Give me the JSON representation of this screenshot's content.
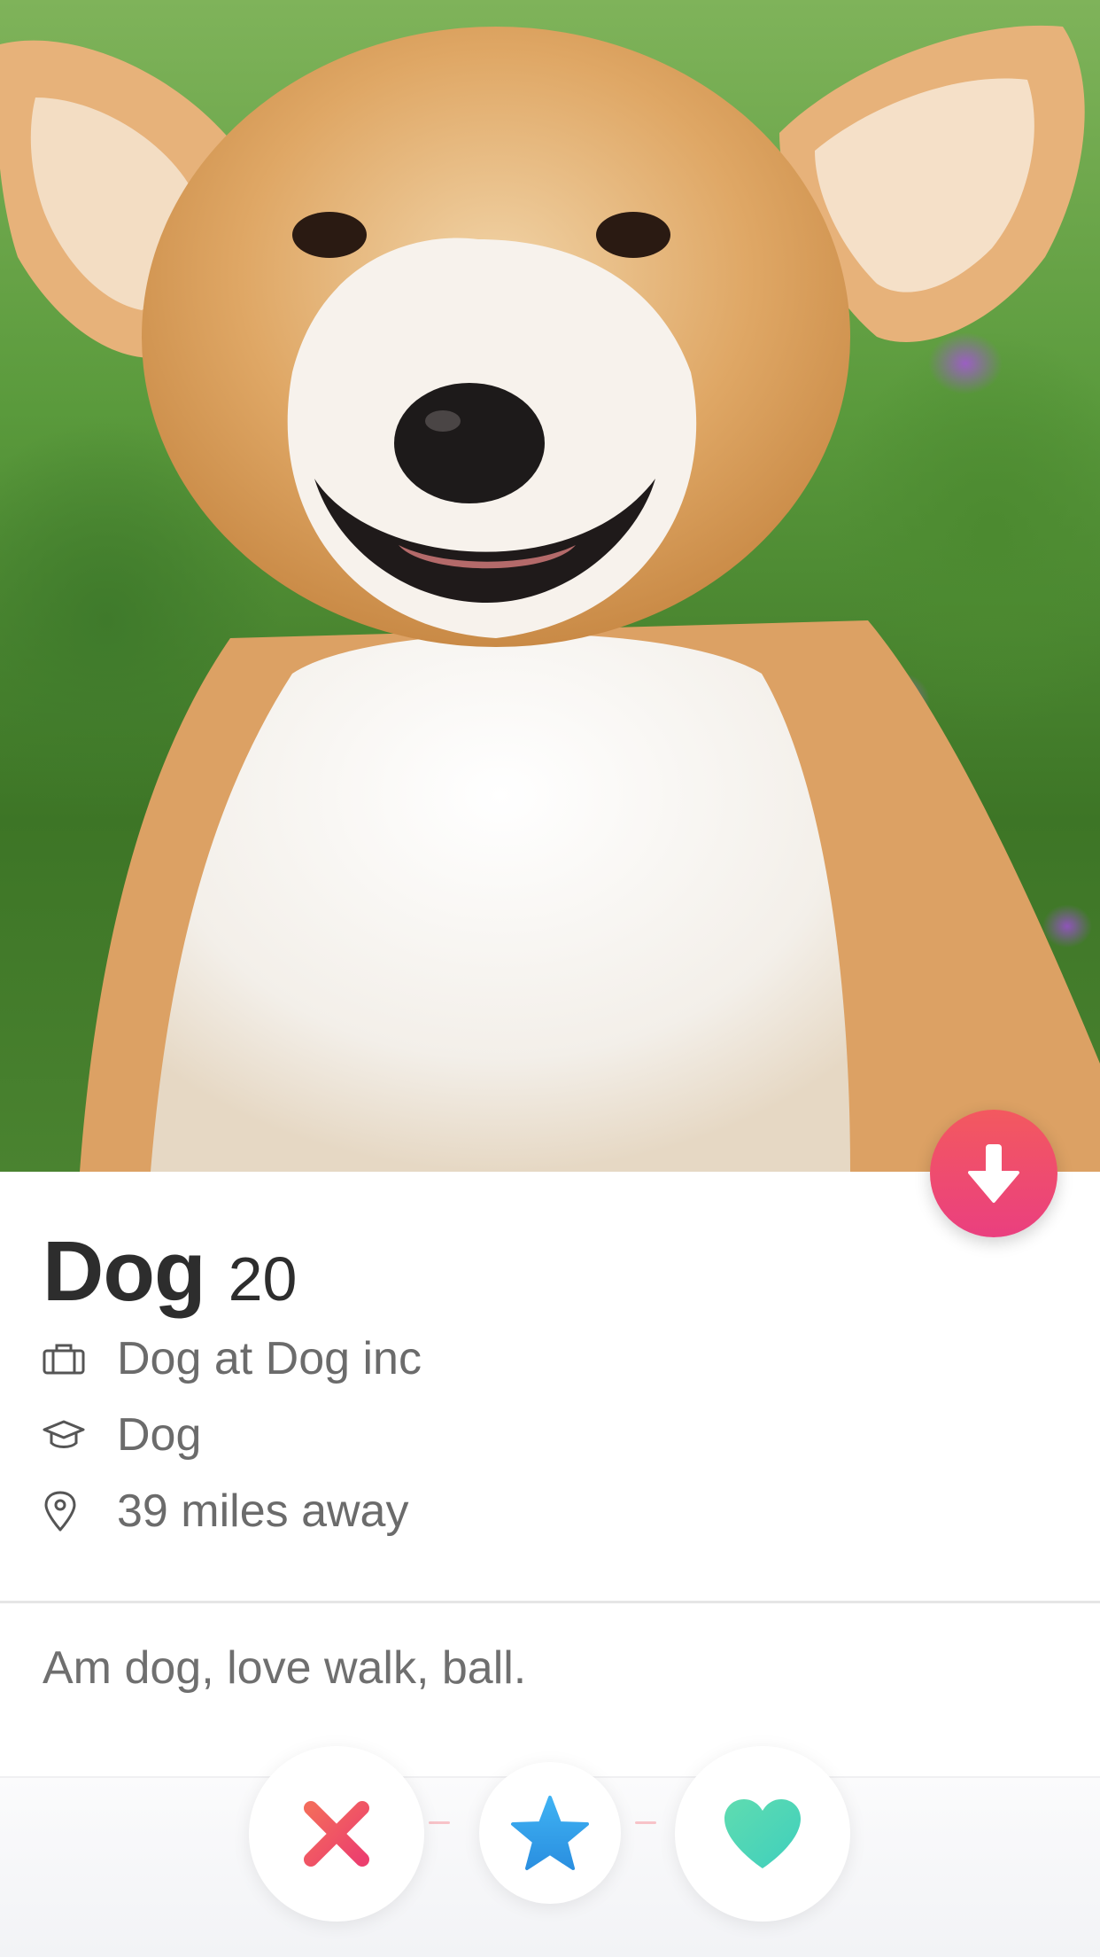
{
  "profile": {
    "name": "Dog",
    "age": "20",
    "job": "Dog at Dog inc",
    "school": "Dog",
    "distance": "39 miles away",
    "bio": "Am dog, love walk, ball."
  },
  "icons": {
    "job": "briefcase-icon",
    "school": "graduation-cap-icon",
    "location": "location-pin-icon",
    "collapse": "arrow-down-icon",
    "nope": "x-icon",
    "super_like": "star-icon",
    "like": "heart-icon"
  },
  "colors": {
    "collapse_button": "#ee4a70",
    "nope": "#f05565",
    "super_like": "#2f9ee8",
    "like": "#58d8b4"
  }
}
